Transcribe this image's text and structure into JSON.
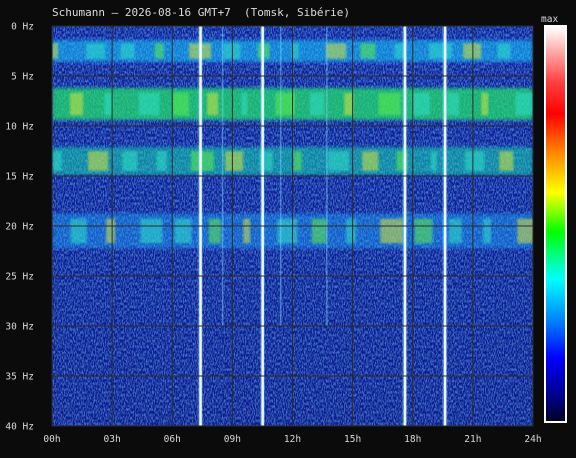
{
  "title": "Schumann – 2026-08-16 GMT+7  (Tomsk, Sibérie)",
  "chart_data": {
    "type": "heatmap",
    "title": "Schumann – 2026-08-16 GMT+7  (Tomsk, Sibérie)",
    "x_ticks": [
      "00h",
      "03h",
      "06h",
      "09h",
      "12h",
      "15h",
      "18h",
      "21h",
      "24h"
    ],
    "x_range_hours": [
      0,
      24
    ],
    "y_ticks": [
      "0 Hz",
      "5 Hz",
      "10 Hz",
      "15 Hz",
      "20 Hz",
      "25 Hz",
      "30 Hz",
      "35 Hz",
      "40 Hz"
    ],
    "y_range_hz": [
      0,
      40
    ],
    "grid": true,
    "colorbar_label": "max",
    "colorbar_colors": [
      "#ffffff",
      "#ff0000",
      "#ff8800",
      "#ffff00",
      "#00ff00",
      "#00ffff",
      "#0066ff",
      "#0000cc",
      "#000033"
    ],
    "bands_hz": [
      2.5,
      7.8,
      13.5,
      20.5
    ],
    "bright_vertical_events_hours": [
      7.4,
      10.5,
      17.6,
      19.6
    ],
    "faint_vertical_events_hours": [
      8.5,
      11.4,
      13.7
    ]
  }
}
